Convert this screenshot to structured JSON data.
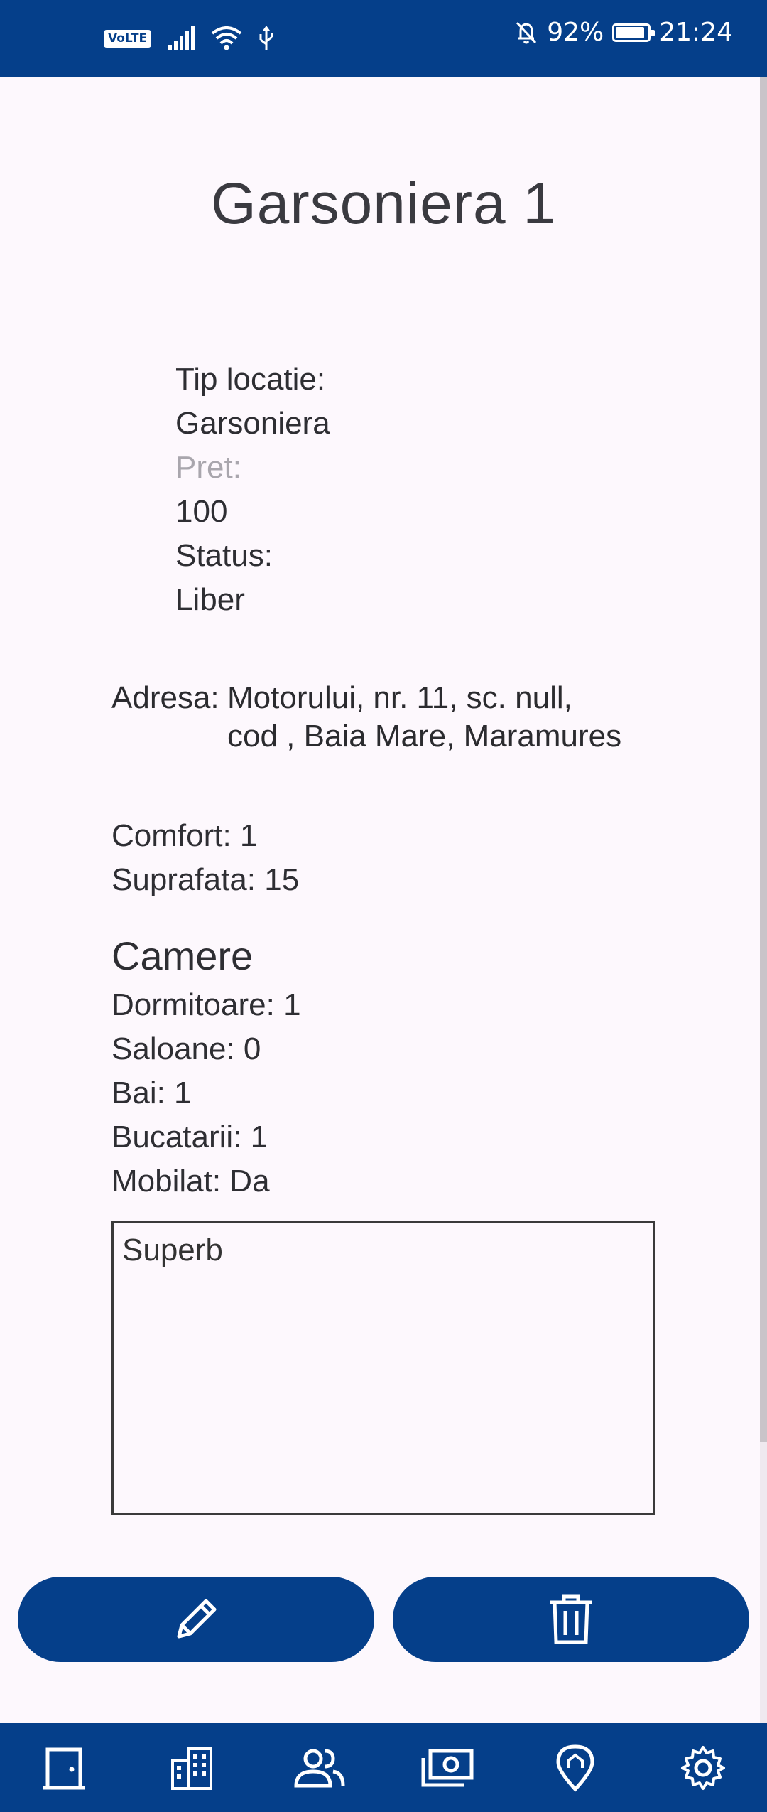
{
  "status_bar": {
    "network_badge": "VoLTE",
    "battery_percent": "92%",
    "battery_level": 0.92,
    "time": "21:24",
    "icons": [
      "signal-icon",
      "wifi-icon",
      "usb-icon",
      "notifications-off-icon",
      "battery-charging-icon"
    ]
  },
  "page": {
    "title": "Garsoniera 1"
  },
  "details": {
    "tip_label": "Tip locatie:",
    "tip_value": "Garsoniera",
    "pret_label": "Pret:",
    "pret_value": "100",
    "status_label": "Status:",
    "status_value": "Liber"
  },
  "address": {
    "label": "Adresa:",
    "line1": "Motorului, nr. 11, sc. null,",
    "line2": "cod , Baia Mare, Maramures"
  },
  "specs": {
    "comfort": "Comfort: 1",
    "suprafata": "Suprafata: 15"
  },
  "rooms": {
    "title": "Camere",
    "dormitoare": "Dormitoare: 1",
    "saloane": "Saloane: 0",
    "bai": "Bai: 1",
    "bucatarii": "Bucatarii: 1",
    "mobilat": "Mobilat: Da"
  },
  "notes": {
    "value": "Superb"
  },
  "actions": {
    "edit_icon": "pencil-icon",
    "delete_icon": "trash-icon"
  },
  "bottom_nav": {
    "items": [
      "door-icon",
      "buildings-icon",
      "people-icon",
      "money-icon",
      "location-home-icon",
      "settings-gear-icon"
    ]
  },
  "colors": {
    "primary": "#053f8a",
    "background": "#fdf8fd",
    "text": "#2e2e33",
    "muted": "#a9a6ad"
  }
}
